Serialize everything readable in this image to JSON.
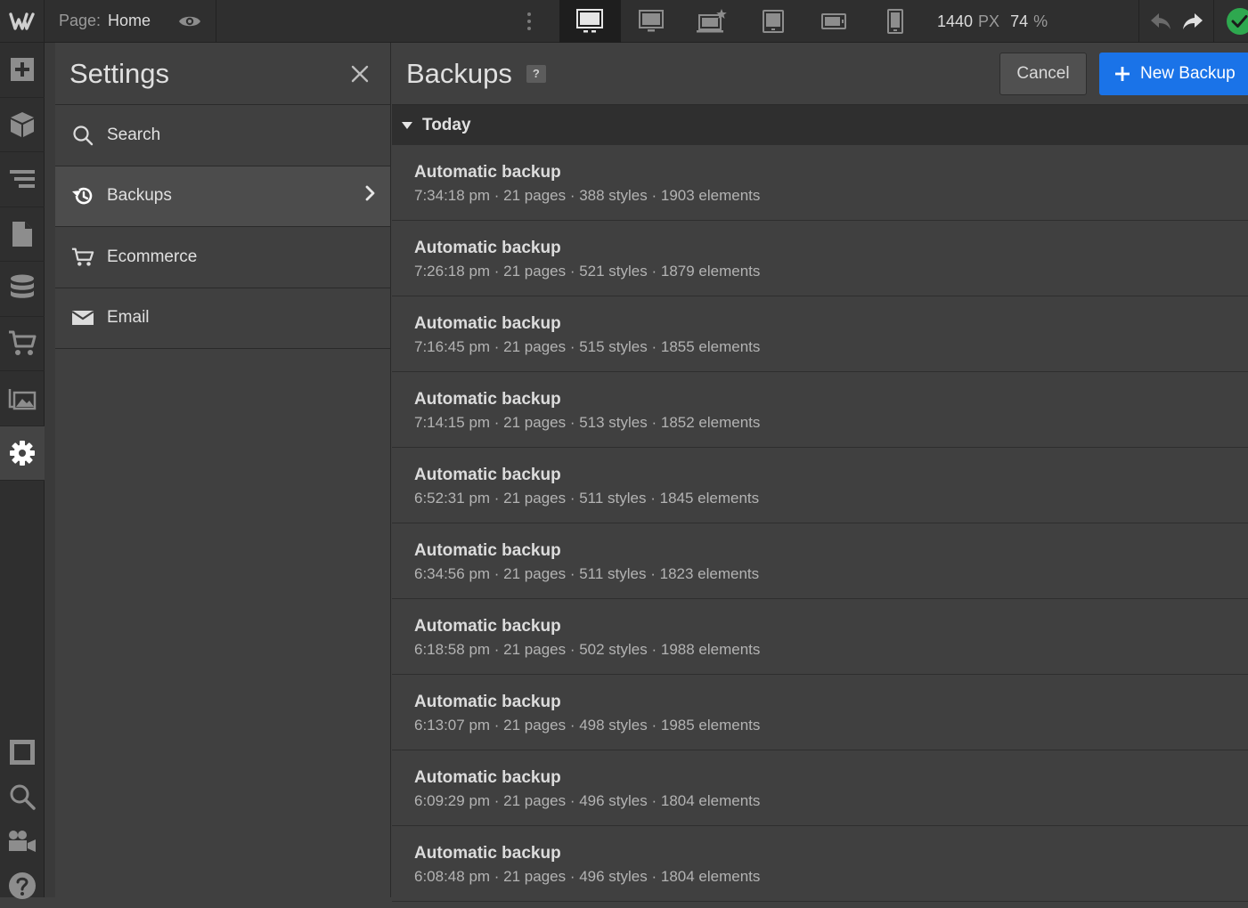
{
  "topbar": {
    "page_label": "Page:",
    "page_name": "Home",
    "width_value": "1440",
    "width_unit": "PX",
    "zoom_value": "74",
    "zoom_unit": "%"
  },
  "settings": {
    "title": "Settings",
    "items": [
      {
        "label": "Search",
        "icon": "search-icon"
      },
      {
        "label": "Backups",
        "icon": "history-icon"
      },
      {
        "label": "Ecommerce",
        "icon": "cart-icon"
      },
      {
        "label": "Email",
        "icon": "envelope-icon"
      }
    ]
  },
  "main": {
    "title": "Backups",
    "help": "?",
    "cancel_label": "Cancel",
    "new_label": "New Backup",
    "group_label": "Today",
    "backups": [
      {
        "title": "Automatic backup",
        "meta": "7:34:18 pm · 21 pages · 388 styles · 1903 elements"
      },
      {
        "title": "Automatic backup",
        "meta": "7:26:18 pm · 21 pages · 521 styles · 1879 elements"
      },
      {
        "title": "Automatic backup",
        "meta": "7:16:45 pm · 21 pages · 515 styles · 1855 elements"
      },
      {
        "title": "Automatic backup",
        "meta": "7:14:15 pm · 21 pages · 513 styles · 1852 elements"
      },
      {
        "title": "Automatic backup",
        "meta": "6:52:31 pm · 21 pages · 511 styles · 1845 elements"
      },
      {
        "title": "Automatic backup",
        "meta": "6:34:56 pm · 21 pages · 511 styles · 1823 elements"
      },
      {
        "title": "Automatic backup",
        "meta": "6:18:58 pm · 21 pages · 502 styles · 1988 elements"
      },
      {
        "title": "Automatic backup",
        "meta": "6:13:07 pm · 21 pages · 498 styles · 1985 elements"
      },
      {
        "title": "Automatic backup",
        "meta": "6:09:29 pm · 21 pages · 496 styles · 1804 elements"
      },
      {
        "title": "Automatic backup",
        "meta": "6:08:48 pm · 21 pages · 496 styles · 1804 elements"
      }
    ]
  },
  "colors": {
    "accent": "#1a73e8",
    "success": "#2ea84f"
  }
}
